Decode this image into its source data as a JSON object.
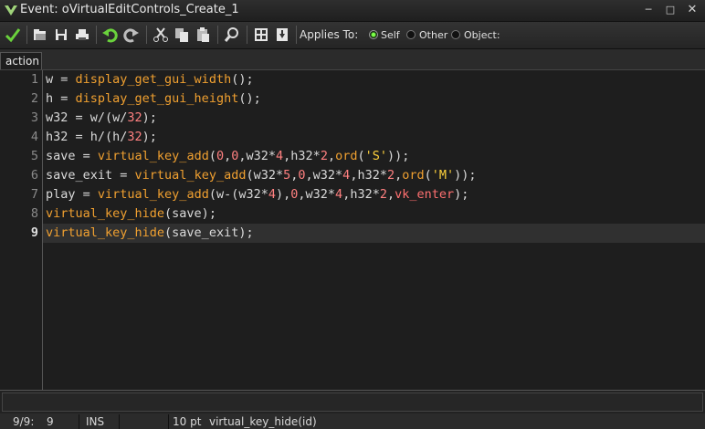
{
  "window": {
    "title": "Event: oVirtualEditControls_Create_1",
    "icon": "gamemaker-logo-icon",
    "buttons": [
      "minimize-icon",
      "maximize-icon",
      "close-icon"
    ]
  },
  "toolbar": {
    "buttons": [
      {
        "name": "confirm-checkmark-icon"
      },
      {
        "name": "open-file-icon"
      },
      {
        "name": "save-icon"
      },
      {
        "name": "print-icon"
      },
      {
        "name": "undo-icon"
      },
      {
        "name": "redo-icon"
      },
      {
        "name": "cut-icon"
      },
      {
        "name": "copy-icon"
      },
      {
        "name": "paste-icon"
      },
      {
        "name": "find-icon"
      },
      {
        "name": "grid-icon"
      },
      {
        "name": "insert-icon"
      }
    ],
    "applies_to_label": "Applies To:",
    "applies_options": [
      {
        "label": "Self",
        "checked": true
      },
      {
        "label": "Other",
        "checked": false
      },
      {
        "label": "Object:",
        "checked": false
      }
    ]
  },
  "tabs": [
    {
      "label": "action",
      "active": true
    }
  ],
  "editor": {
    "current_line": 9,
    "line_numbers": [
      "1",
      "2",
      "3",
      "4",
      "5",
      "6",
      "7",
      "8",
      "9"
    ],
    "lines": [
      [
        [
          "fn",
          "display_get_gui_width"
        ]
      ],
      [
        [
          "fn",
          "display_get_gui_height"
        ]
      ],
      [],
      [],
      [],
      [],
      [],
      [],
      []
    ],
    "code": [
      [
        [
          "txt",
          "w = "
        ],
        [
          "fn",
          "display_get_gui_width"
        ],
        [
          "txt",
          "();"
        ]
      ],
      [
        [
          "txt",
          "h = "
        ],
        [
          "fn",
          "display_get_gui_height"
        ],
        [
          "txt",
          "();"
        ]
      ],
      [
        [
          "txt",
          "w32 = w/(w/"
        ],
        [
          "num",
          "32"
        ],
        [
          "txt",
          ");"
        ]
      ],
      [
        [
          "txt",
          "h32 = h/(h/"
        ],
        [
          "num",
          "32"
        ],
        [
          "txt",
          ");"
        ]
      ],
      [
        [
          "txt",
          "save = "
        ],
        [
          "fn",
          "virtual_key_add"
        ],
        [
          "txt",
          "("
        ],
        [
          "num",
          "0"
        ],
        [
          "txt",
          ","
        ],
        [
          "num",
          "0"
        ],
        [
          "txt",
          ",w32*"
        ],
        [
          "num",
          "4"
        ],
        [
          "txt",
          ",h32*"
        ],
        [
          "num",
          "2"
        ],
        [
          "txt",
          ","
        ],
        [
          "fn",
          "ord"
        ],
        [
          "txt",
          "("
        ],
        [
          "str",
          "'S'"
        ],
        [
          "txt",
          "));"
        ]
      ],
      [
        [
          "txt",
          "save_exit = "
        ],
        [
          "fn",
          "virtual_key_add"
        ],
        [
          "txt",
          "(w32*"
        ],
        [
          "num",
          "5"
        ],
        [
          "txt",
          ","
        ],
        [
          "num",
          "0"
        ],
        [
          "txt",
          ",w32*"
        ],
        [
          "num",
          "4"
        ],
        [
          "txt",
          ",h32*"
        ],
        [
          "num",
          "2"
        ],
        [
          "txt",
          ","
        ],
        [
          "fn",
          "ord"
        ],
        [
          "txt",
          "("
        ],
        [
          "str",
          "'M'"
        ],
        [
          "txt",
          "));"
        ]
      ],
      [
        [
          "txt",
          "play = "
        ],
        [
          "fn",
          "virtual_key_add"
        ],
        [
          "txt",
          "(w-(w32*"
        ],
        [
          "num",
          "4"
        ],
        [
          "txt",
          "),"
        ],
        [
          "num",
          "0"
        ],
        [
          "txt",
          ",w32*"
        ],
        [
          "num",
          "4"
        ],
        [
          "txt",
          ",h32*"
        ],
        [
          "num",
          "2"
        ],
        [
          "txt",
          ","
        ],
        [
          "kw",
          "vk_enter"
        ],
        [
          "txt",
          ");"
        ]
      ],
      [
        [
          "fn",
          "virtual_key_hide"
        ],
        [
          "txt",
          "(save);"
        ]
      ],
      [
        [
          "fn",
          "virtual_key_hide"
        ],
        [
          "txt",
          "(save_exit);"
        ]
      ]
    ]
  },
  "status": {
    "position": "9/9:",
    "column": "9",
    "mode": "INS",
    "font_size": "10 pt",
    "hint": "virtual_key_hide(id)"
  },
  "colors": {
    "function": "#f0a030",
    "number": "#ff8080",
    "string": "#ffd23c",
    "constant": "#ff7070",
    "text": "#dadada",
    "background": "#1e1e1e"
  }
}
